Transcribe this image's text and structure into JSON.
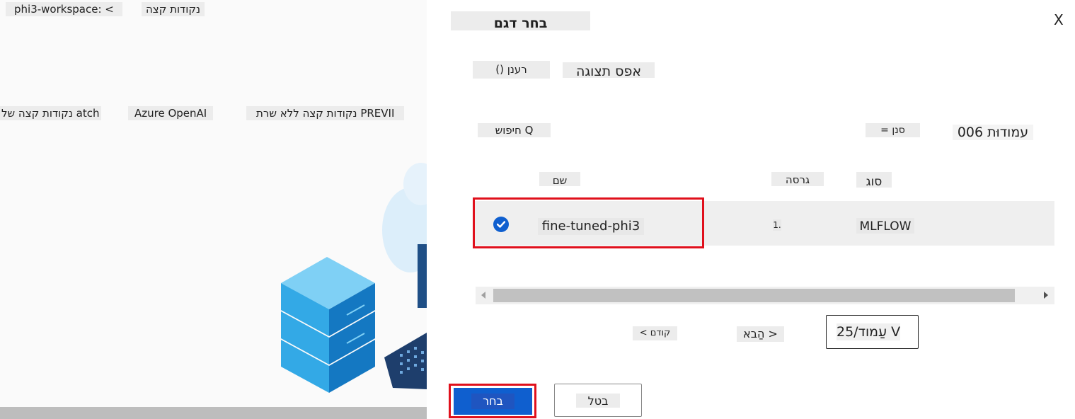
{
  "background": {
    "breadcrumb_workspace": "phi3-workspace: <",
    "breadcrumb_endpoints": "נקודות קצה",
    "tab_batch": "נקודות קצה של atch",
    "tab_azure_openai": "Azure OpenAI",
    "tab_serverless": "נקודות קצה ללא שרת PREVII"
  },
  "dialog": {
    "close_label": "X",
    "title": "בחר דגם",
    "refresh_label": "() רענן",
    "reset_view_label": "אפס תצוגה",
    "search_label": "חיפוש Q",
    "filter_label": "= סנן",
    "columns_label": "006 עמודוּת",
    "table": {
      "headers": {
        "name": "שם",
        "version": "גרסה",
        "type": "סוג"
      },
      "rows": [
        {
          "name": "fine-tuned-phi3",
          "version": "1.",
          "type": "MLFLOW",
          "selected": true
        }
      ]
    },
    "pagination": {
      "prev_label": "< קודם",
      "next_label": "הַבא >",
      "page_size_label": "25/עַמוד V"
    },
    "select_button": "בחר",
    "cancel_button": "בטל"
  },
  "colors": {
    "accent": "#0f5fcf",
    "highlight_border": "#e0101c",
    "selected_row": "#efefef"
  }
}
